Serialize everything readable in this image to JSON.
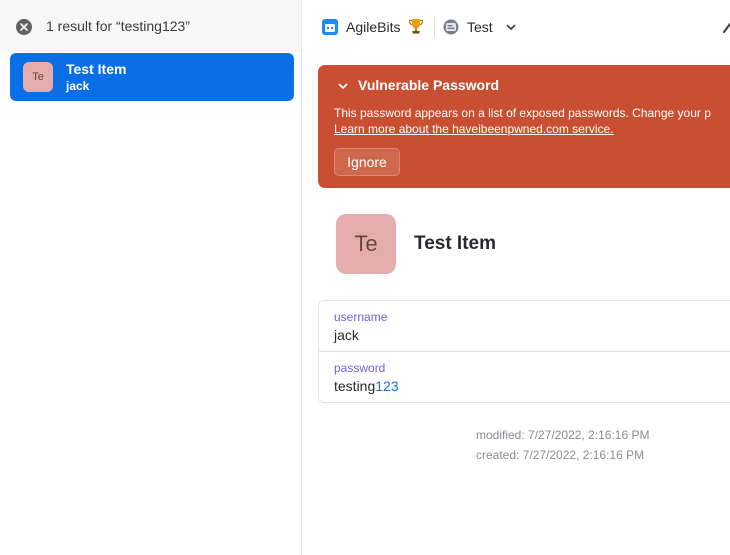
{
  "search": {
    "result_count": "1 result for “testing123”"
  },
  "results": [
    {
      "avatar": "Te",
      "title": "Test Item",
      "subtitle": "jack"
    }
  ],
  "header": {
    "account_name": "AgileBits",
    "vault_name": "Test"
  },
  "alert": {
    "title": "Vulnerable Password",
    "message": "This password appears on a list of exposed passwords. Change your p",
    "link": "Learn more about the haveibeenpwned.com service.",
    "ignore_label": "Ignore",
    "color": "#c94f33"
  },
  "item": {
    "avatar": "Te",
    "title": "Test Item",
    "fields": [
      {
        "label": "username",
        "value": "jack"
      },
      {
        "label": "password",
        "value_letters": "testing",
        "value_digits": "123"
      }
    ],
    "modified": "modified: 7/27/2022, 2:16:16 PM",
    "created": "created: 7/27/2022, 2:16:16 PM"
  },
  "colors": {
    "accent": "#0a6fe6",
    "avatar_bg": "#e5acae",
    "field_label": "#6f62d8",
    "password_digits": "#1f6fd0"
  },
  "icons": [
    "close-circle-icon",
    "account-icon",
    "trophy-icon",
    "vault-icon",
    "chevron-down-icon"
  ]
}
